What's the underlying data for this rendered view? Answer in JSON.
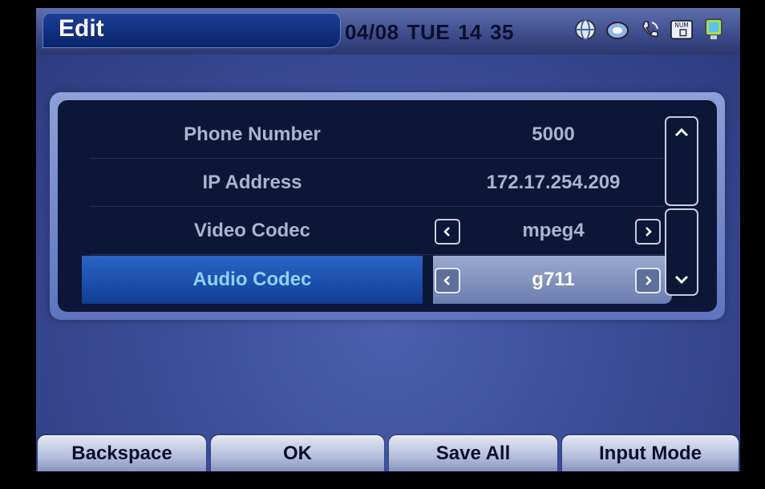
{
  "header": {
    "title": "Edit",
    "date": "04/08",
    "day": "TUE",
    "hour": "14",
    "minute": "35",
    "icons": [
      "globe-icon",
      "network-icon",
      "phone-icon",
      "num-keypad-icon",
      "monitor-icon"
    ],
    "num_label": "NUM"
  },
  "settings": {
    "rows": [
      {
        "label": "Phone Number",
        "value": "5000"
      },
      {
        "label": "IP Address",
        "value": "172.17.254.209"
      },
      {
        "label": "Video Codec",
        "value": "mpeg4"
      },
      {
        "label": "Audio Codec",
        "value": "g711"
      }
    ],
    "selected_index": 3
  },
  "softkeys": [
    "Backspace",
    "OK",
    "Save All",
    "Input Mode"
  ],
  "colors": {
    "screen_bg": "#3b4d98",
    "panel_bg": "#0c1637",
    "selected_label": "#8fd0ff",
    "text_dim": "#aab4cc"
  }
}
